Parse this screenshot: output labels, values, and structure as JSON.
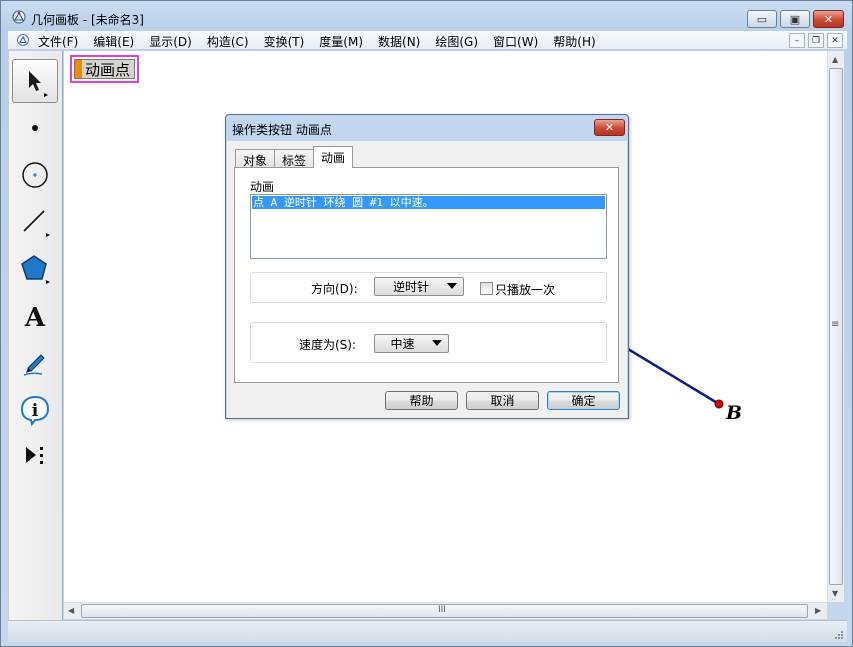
{
  "window": {
    "title": "几何画板 - [未命名3]",
    "minimize_glyph": "▭",
    "maximize_glyph": "▣",
    "close_glyph": "✕"
  },
  "menu": {
    "items": [
      "文件(F)",
      "编辑(E)",
      "显示(D)",
      "构造(C)",
      "变换(T)",
      "度量(M)",
      "数据(N)",
      "绘图(G)",
      "窗口(W)",
      "帮助(H)"
    ]
  },
  "toolbox": {
    "tools": [
      "arrow-select-tool",
      "point-tool",
      "compass-tool",
      "straightedge-tool",
      "polygon-tool",
      "text-tool",
      "marker-tool",
      "information-tool",
      "custom-tool"
    ]
  },
  "canvas": {
    "action_button_label": "动画点",
    "point_label": "B",
    "point_color": "#e00000",
    "segment_color": "#0a1f8f",
    "button_swatch_color": "#f08a00",
    "button_highlight_color": "#e040e0"
  },
  "dialog": {
    "title": "操作类按钮 动画点",
    "close_glyph": "✕",
    "tabs": [
      {
        "label": "对象",
        "active": false
      },
      {
        "label": "标签",
        "active": false
      },
      {
        "label": "动画",
        "active": true
      }
    ],
    "animation_group_label": "动画",
    "animation_list_selected": "点 A 逆时针 环绕 圆 #1 以中速。",
    "direction_label": "方向(D):",
    "direction_value": "逆时针",
    "play_once_label": "只播放一次",
    "play_once_checked": false,
    "speed_label": "速度为(S):",
    "speed_value": "中速",
    "buttons": {
      "help": "帮助",
      "cancel": "取消",
      "ok": "确定"
    }
  },
  "scrollbars": {
    "thumb_grip": "III",
    "vertical_grip": "≡"
  }
}
